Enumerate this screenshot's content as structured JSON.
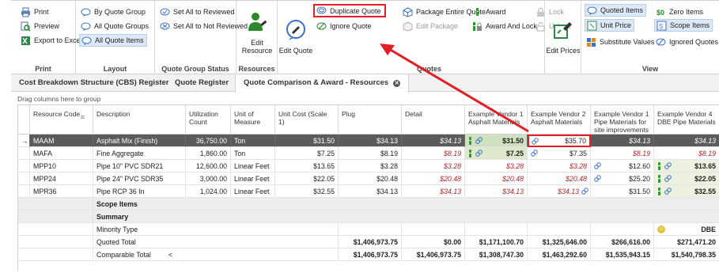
{
  "ribbon": {
    "print_group": {
      "label": "Print",
      "items": [
        "Print",
        "Preview",
        "Export to Excel"
      ]
    },
    "layout_group": {
      "label": "Layout",
      "items": [
        "By Quote Group",
        "All Quote Groups",
        "All Quote Items"
      ]
    },
    "status_group": {
      "label": "Quote Group Status",
      "items": [
        "Set All to Reviewed",
        "Set All to Not Reviewed"
      ]
    },
    "resources_group": {
      "label": "Resources",
      "button": "Edit Resource"
    },
    "edit_quote": "Edit Quote",
    "quotes_group": {
      "label": "Quotes",
      "duplicate_quote": "Duplicate Quote",
      "ignore_quote": "Ignore Quote",
      "package_entire_quote": "Package Entire Quote",
      "edit_package": "Edit Package",
      "award": "Award",
      "award_and_lock": "Award And Lock",
      "lock": "Lock",
      "unlock": "Unlock",
      "edit_prices": "Edit Prices"
    },
    "view_group": {
      "label": "View",
      "quoted_items": "Quoted Items",
      "unit_price": "Unit Price",
      "substitute_values": "Substitute Values",
      "zero_items": "Zero Items",
      "scope_items": "Scope Items",
      "ignored_quotes": "Ignored Quotes"
    }
  },
  "tabs": [
    "Cost Breakdown Structure (CBS) Register",
    "Quote Register",
    "Quote Comparison & Award - Resources"
  ],
  "drag_hint": "Drag columns here to group",
  "columns": {
    "code": "Resource Code",
    "desc": "Description",
    "util": "Utilization Count",
    "uom": "Unit of Measure",
    "cost": "Unit Cost (Scale 1)",
    "plug": "Plug",
    "detail": "Detail",
    "v1": "Example Vendor 1 Asphalt Materials",
    "v2": "Example Vendor 2 Asphalt Materials",
    "v1b": "Example Vendor 1 Pipe Materials for site improvements",
    "v4": "Example Vendor 4 DBE Pipe Materials"
  },
  "rows": [
    {
      "code": "MAAM",
      "desc": "Asphalt Mix (Finish)",
      "util": "36,750.00",
      "uom": "Ton",
      "cost": "$31.50",
      "plug": "$34.13",
      "detail": "$34.13",
      "v1": "$31.50",
      "v2": "$35.70",
      "v1b": "$34.13",
      "v4": "$34.13"
    },
    {
      "code": "MAFA",
      "desc": "Fine Aggregate",
      "util": "1,860.00",
      "uom": "Ton",
      "cost": "$7.25",
      "plug": "$8.19",
      "detail": "$8.19",
      "v1": "$7.25",
      "v2": "$7.35",
      "v1b": "$8.19",
      "v4": "$8.19"
    },
    {
      "code": "MPP10",
      "desc": "Pipe 10\" PVC SDR21",
      "util": "12,600.00",
      "uom": "Linear Feet",
      "cost": "$13.65",
      "plug": "$3.28",
      "detail": "$3.28",
      "v1": "$3.28",
      "v2": "$3.28",
      "v1b": "$12.60",
      "v4": "$13.65"
    },
    {
      "code": "MPP24",
      "desc": "Pipe 24\" PVC SDR35",
      "util": "3,000.00",
      "uom": "Linear Feet",
      "cost": "$22.05",
      "plug": "$20.48",
      "detail": "$20.48",
      "v1": "$20.48",
      "v2": "$20.48",
      "v1b": "$25.20",
      "v4": "$22.05"
    },
    {
      "code": "MPR36",
      "desc": "Pipe RCP 36 In",
      "util": "1,024.00",
      "uom": "Linear Feet",
      "cost": "$32.55",
      "plug": "$34.13",
      "detail": "$34.13",
      "v1": "$34.13",
      "v2": "$34.13",
      "v1b": "$31.50",
      "v4": "$32.55"
    }
  ],
  "summary": {
    "scope_items": "Scope Items",
    "summary": "Summary",
    "minority_type": "Minority Type",
    "minority_v4": "DBE",
    "quoted_total": "Quoted Total",
    "quoted": {
      "plug": "$1,406,973.75",
      "detail": "$0.00",
      "v1": "$1,171,100.70",
      "v2": "$1,325,646.00",
      "v1b": "$266,616.00",
      "v4": "$271,471.20"
    },
    "comparable_total": "Comparable Total",
    "comparable_marker": "<",
    "comparable": {
      "plug": "$1,406,973.75",
      "detail": "$1,406,973.75",
      "v1": "$1,308,747.30",
      "v2": "$1,463,292.60",
      "v1b": "$1,535,943.15",
      "v4": "$1,540,798.35"
    }
  },
  "row_pointer": "→",
  "colors": {
    "accent_red": "#e31e26",
    "selected_row": "#5b5b5b",
    "award_green": "#2a9a2a",
    "link_blue": "#3b73c4"
  }
}
